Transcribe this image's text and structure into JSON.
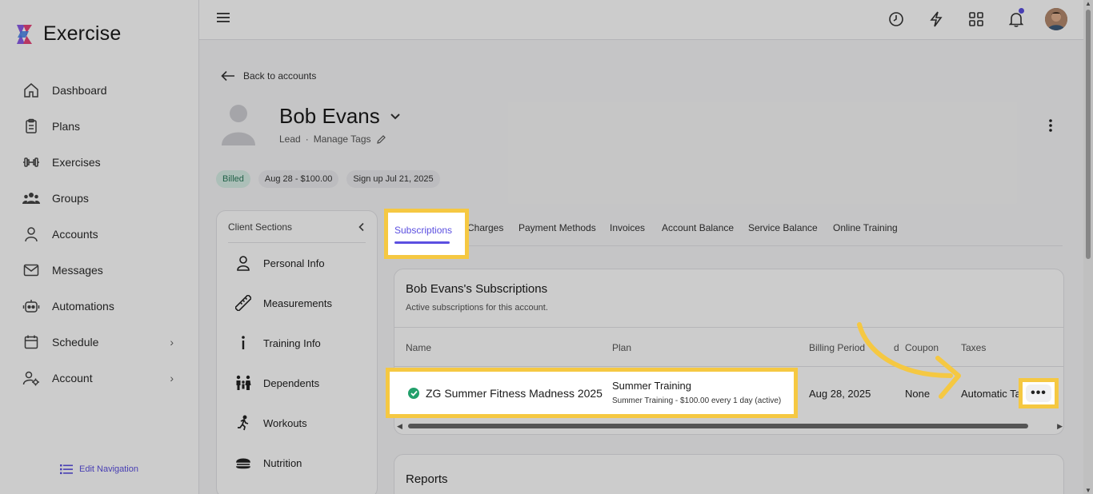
{
  "app": {
    "name": "Exercise",
    "edit_navigation": "Edit Navigation"
  },
  "nav": [
    {
      "label": "Dashboard",
      "icon": "home-icon"
    },
    {
      "label": "Plans",
      "icon": "clipboard-icon"
    },
    {
      "label": "Exercises",
      "icon": "dumbbell-icon"
    },
    {
      "label": "Groups",
      "icon": "users-icon"
    },
    {
      "label": "Accounts",
      "icon": "user-icon"
    },
    {
      "label": "Messages",
      "icon": "mail-icon"
    },
    {
      "label": "Automations",
      "icon": "robot-icon"
    },
    {
      "label": "Schedule",
      "icon": "calendar-icon"
    },
    {
      "label": "Account",
      "icon": "user-settings-icon"
    }
  ],
  "account": {
    "back_label": "Back to accounts",
    "name": "Bob Evans",
    "role": "Lead",
    "separator": "·",
    "manage_tags": "Manage Tags",
    "chips": {
      "billed": "Billed",
      "payment": "Aug 28 - $100.00",
      "signup": "Sign up Jul 21, 2025"
    }
  },
  "client_sections": {
    "title": "Client Sections",
    "items": [
      {
        "label": "Personal Info",
        "icon": "person-icon"
      },
      {
        "label": "Measurements",
        "icon": "ruler-icon"
      },
      {
        "label": "Training Info",
        "icon": "info-icon"
      },
      {
        "label": "Dependents",
        "icon": "family-icon"
      },
      {
        "label": "Workouts",
        "icon": "running-icon"
      },
      {
        "label": "Nutrition",
        "icon": "food-icon"
      }
    ]
  },
  "tabs": {
    "subscriptions": "Subscriptions",
    "charges": "Charges",
    "payment_methods": "Payment Methods",
    "invoices": "Invoices",
    "account_balance": "Account Balance",
    "service_balance": "Service Balance",
    "online_training": "Online Training"
  },
  "subscriptions": {
    "title": "Bob Evans's Subscriptions",
    "subtitle": "Active subscriptions for this account.",
    "columns": {
      "name": "Name",
      "plan": "Plan",
      "billing_period": "Billing Period",
      "billing_period_tail": "d",
      "coupon": "Coupon",
      "taxes": "Taxes"
    },
    "row": {
      "name": "ZG Summer Fitness Madness 2025",
      "plan": "Summer Training",
      "plan_detail": "Summer Training - $100.00 every 1 day (active)",
      "billing_period": "Aug 28, 2025",
      "coupon": "None",
      "taxes": "Automatic Ta",
      "more": "•••"
    }
  },
  "reports": {
    "title": "Reports"
  },
  "colors": {
    "accent": "#5b4fe0",
    "highlight": "#f5c842",
    "success": "#22a06b"
  }
}
